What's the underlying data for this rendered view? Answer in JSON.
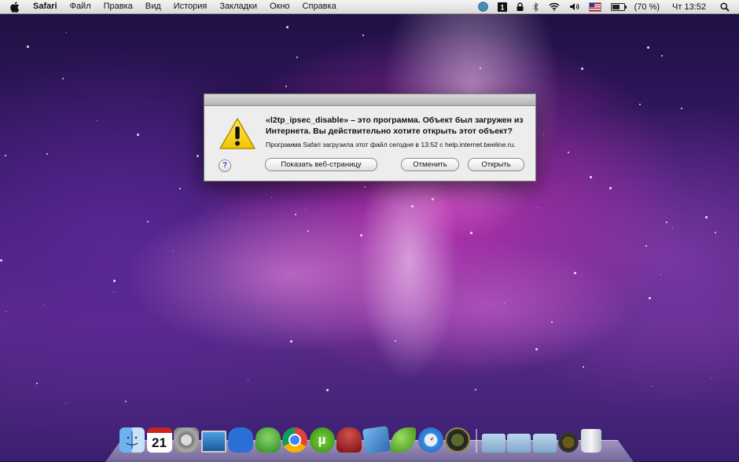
{
  "menubar": {
    "app_name": "Safari",
    "menus": [
      "Файл",
      "Правка",
      "Вид",
      "История",
      "Закладки",
      "Окно",
      "Справка"
    ],
    "battery_text": "(70 %)",
    "clock": "Чт 13:52",
    "status_icons": [
      "globe-icon",
      "input-language-icon",
      "lock-icon",
      "bluetooth-icon",
      "wifi-icon",
      "volume-icon",
      "us-flag-icon",
      "battery-icon",
      "spotlight-icon"
    ]
  },
  "dialog": {
    "message": "«l2tp_ipsec_disable» – это программа. Объект был загружен из Интернета. Вы действительно хотите открыть этот объект?",
    "info": "Программа Safari загрузила этот файл сегодня в 13:52 с help.internet.beeline.ru.",
    "help_label": "?",
    "show_page_label": "Показать веб-страницу",
    "cancel_label": "Отменить",
    "open_label": "Открыть"
  },
  "dock": {
    "apps": [
      "finder-icon",
      "ical-icon",
      "system-preferences-icon",
      "remote-desktop-icon",
      "cyberduck-icon",
      "adium-icon",
      "chrome-icon",
      "utorrent-icon",
      "transmission-icon",
      "xcode-icon",
      "growl-icon",
      "safari-icon",
      "time-machine-icon"
    ],
    "ical_day": "21",
    "stacks": [
      "applications-folder-icon",
      "documents-folder-icon",
      "downloads-folder-icon",
      "time-machine-stack-icon",
      "trash-icon"
    ]
  },
  "colors": {
    "accent_warning": "#f2c500",
    "wallpaper_primary": "#c030b0"
  }
}
